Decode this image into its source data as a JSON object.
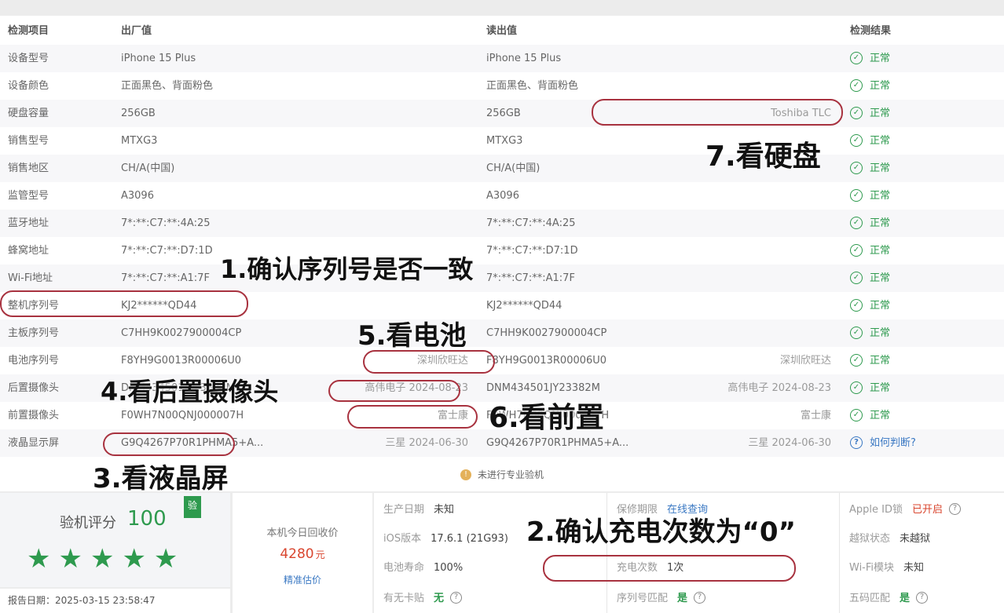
{
  "table": {
    "headers": {
      "item": "检测项目",
      "factory": "出厂值",
      "read": "读出值",
      "result": "检测结果"
    },
    "rows": [
      {
        "item": "设备型号",
        "factory": "iPhone 15 Plus",
        "factory_extra": "",
        "read": "iPhone 15 Plus",
        "read_extra": "",
        "result": "正常"
      },
      {
        "item": "设备颜色",
        "factory": "正面黑色、背面粉色",
        "factory_extra": "",
        "read": "正面黑色、背面粉色",
        "read_extra": "",
        "result": "正常"
      },
      {
        "item": "硬盘容量",
        "factory": "256GB",
        "factory_extra": "",
        "read": "256GB",
        "read_extra": "Toshiba TLC",
        "result": "正常"
      },
      {
        "item": "销售型号",
        "factory": "MTXG3",
        "factory_extra": "",
        "read": "MTXG3",
        "read_extra": "",
        "result": "正常"
      },
      {
        "item": "销售地区",
        "factory": "CH/A(中国)",
        "factory_extra": "",
        "read": "CH/A(中国)",
        "read_extra": "",
        "result": "正常"
      },
      {
        "item": "监管型号",
        "factory": "A3096",
        "factory_extra": "",
        "read": "A3096",
        "read_extra": "",
        "result": "正常"
      },
      {
        "item": "蓝牙地址",
        "factory": "7*:**:C7:**:4A:25",
        "factory_extra": "",
        "read": "7*:**:C7:**:4A:25",
        "read_extra": "",
        "result": "正常"
      },
      {
        "item": "蜂窝地址",
        "factory": "7*:**:C7:**:D7:1D",
        "factory_extra": "",
        "read": "7*:**:C7:**:D7:1D",
        "read_extra": "",
        "result": "正常"
      },
      {
        "item": "Wi-Fi地址",
        "factory": "7*:**:C7:**:A1:7F",
        "factory_extra": "",
        "read": "7*:**:C7:**:A1:7F",
        "read_extra": "",
        "result": "正常"
      },
      {
        "item": "整机序列号",
        "factory": "KJ2******QD44",
        "factory_extra": "",
        "read": "KJ2******QD44",
        "read_extra": "",
        "result": "正常"
      },
      {
        "item": "主板序列号",
        "factory": "C7HH9K0027900004CP",
        "factory_extra": "",
        "read": "C7HH9K0027900004CP",
        "read_extra": "",
        "result": "正常"
      },
      {
        "item": "电池序列号",
        "factory": "F8YH9G0013R00006U0",
        "factory_extra": "深圳欣旺达",
        "read": "F8YH9G0013R00006U0",
        "read_extra": "深圳欣旺达",
        "result": "正常"
      },
      {
        "item": "后置摄像头",
        "factory": "DNM434501JY23382M",
        "factory_extra": "高伟电子 2024-08-23",
        "read": "DNM434501JY23382M",
        "read_extra": "高伟电子 2024-08-23",
        "result": "正常"
      },
      {
        "item": "前置摄像头",
        "factory": "F0WH7N00QNJ000007H",
        "factory_extra": "富士康",
        "read": "F0WH7N00QNJ000007H",
        "read_extra": "富士康",
        "result": "正常"
      },
      {
        "item": "液晶显示屏",
        "factory": "G9Q4267P70R1PHMA5+A...",
        "factory_extra": "三星 2024-06-30",
        "read": "G9Q4267P70R1PHMA5+A...",
        "read_extra": "三星 2024-06-30",
        "result": "如何判断?"
      }
    ],
    "not_professional": "未进行专业验机"
  },
  "score": {
    "label": "验机评分",
    "value": "100",
    "stars": "★★★★★",
    "badge": "验",
    "star_count": 5,
    "report_date": "报告日期：2025-03-15 23:58:47"
  },
  "price": {
    "label": "本机今日回收价",
    "value": "4280",
    "unit": "元",
    "link": "精准估价"
  },
  "details": {
    "col1": [
      {
        "label": "生产日期",
        "value": "未知"
      },
      {
        "label": "iOS版本",
        "value": "17.6.1 (21G93)"
      },
      {
        "label": "电池寿命",
        "value": "100%"
      },
      {
        "label": "有无卡贴",
        "value": "无"
      }
    ],
    "col2": [
      {
        "label": "保修期限",
        "value": "在线查询"
      },
      {
        "label": "",
        "value": ""
      },
      {
        "label": "充电次数",
        "value": "1次"
      },
      {
        "label": "序列号匹配",
        "value": "是"
      }
    ],
    "col3": [
      {
        "label": "Apple ID锁",
        "value": "已开启"
      },
      {
        "label": "越狱状态",
        "value": "未越狱"
      },
      {
        "label": "Wi-Fi模块",
        "value": "未知"
      },
      {
        "label": "五码匹配",
        "value": "是"
      }
    ]
  },
  "annotations": {
    "a1": "1.确认序列号是否一致",
    "a2": "2.确认充电次数为“0”",
    "a3": "3.看液晶屏",
    "a4": "4.看后置摄像头",
    "a5": "5.看电池",
    "a6": "6.看前置",
    "a7": "7.看硬盘"
  },
  "colors": {
    "ok_green": "#2e9a4e",
    "link_blue": "#3a78c3",
    "price_red": "#d9452e",
    "ring_red": "#a8323f"
  }
}
